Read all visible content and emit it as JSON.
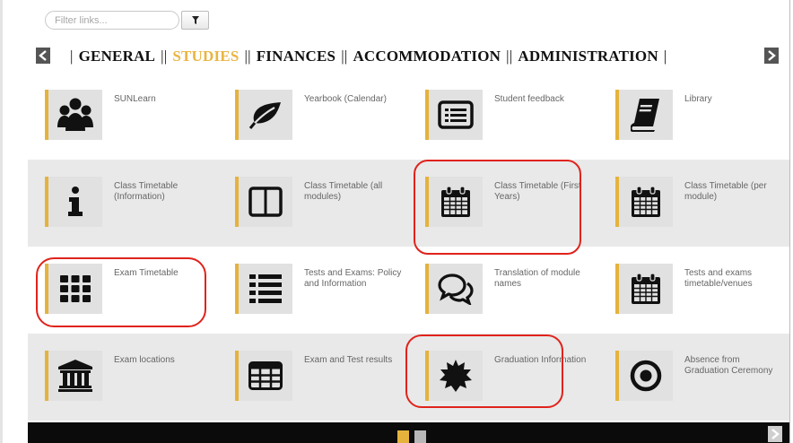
{
  "filter": {
    "placeholder": "Filter links...",
    "button_icon": "funnel-icon"
  },
  "nav": {
    "prev_icon": "chevron-left-icon",
    "next_icon": "chevron-right-icon",
    "tabs": [
      {
        "label": "GENERAL",
        "active": false
      },
      {
        "label": "STUDIES",
        "active": true
      },
      {
        "label": "FINANCES",
        "active": false
      },
      {
        "label": "ACCOMMODATION",
        "active": false
      },
      {
        "label": "ADMINISTRATION",
        "active": false
      }
    ]
  },
  "colors": {
    "accent": "#e5b33c",
    "highlight": "#e0231c",
    "tile_bg": "#e1e1e1",
    "row_shade": "#e9e9e9",
    "footer": "#0b0b0b"
  },
  "tiles": [
    [
      {
        "label": "SUNLearn",
        "icon": "users-icon"
      },
      {
        "label": "Yearbook (Calendar)",
        "icon": "leaf-icon"
      },
      {
        "label": "Student feedback",
        "icon": "list-alt-icon"
      },
      {
        "label": "Library",
        "icon": "book-icon"
      }
    ],
    [
      {
        "label": "Class Timetable (Information)",
        "icon": "info-icon"
      },
      {
        "label": "Class Timetable (all modules)",
        "icon": "columns-icon"
      },
      {
        "label": "Class Timetable (First Years)",
        "icon": "calendar-icon"
      },
      {
        "label": "Class Timetable (per module)",
        "icon": "calendar-icon"
      }
    ],
    [
      {
        "label": "Exam Timetable",
        "icon": "grid-dots-icon"
      },
      {
        "label": "Tests and Exams: Policy and Information",
        "icon": "list-icon"
      },
      {
        "label": "Translation of module names",
        "icon": "comments-icon"
      },
      {
        "label": "Tests and exams timetable/venues",
        "icon": "calendar-icon"
      }
    ],
    [
      {
        "label": "Exam locations",
        "icon": "bank-icon"
      },
      {
        "label": "Exam and Test results",
        "icon": "table-icon"
      },
      {
        "label": "Graduation Information",
        "icon": "certificate-icon"
      },
      {
        "label": "Absence from Graduation Ceremony",
        "icon": "dot-circle-icon"
      }
    ]
  ],
  "pager": {
    "pages": 2,
    "current": 1,
    "next_icon": "chevron-right-icon"
  }
}
